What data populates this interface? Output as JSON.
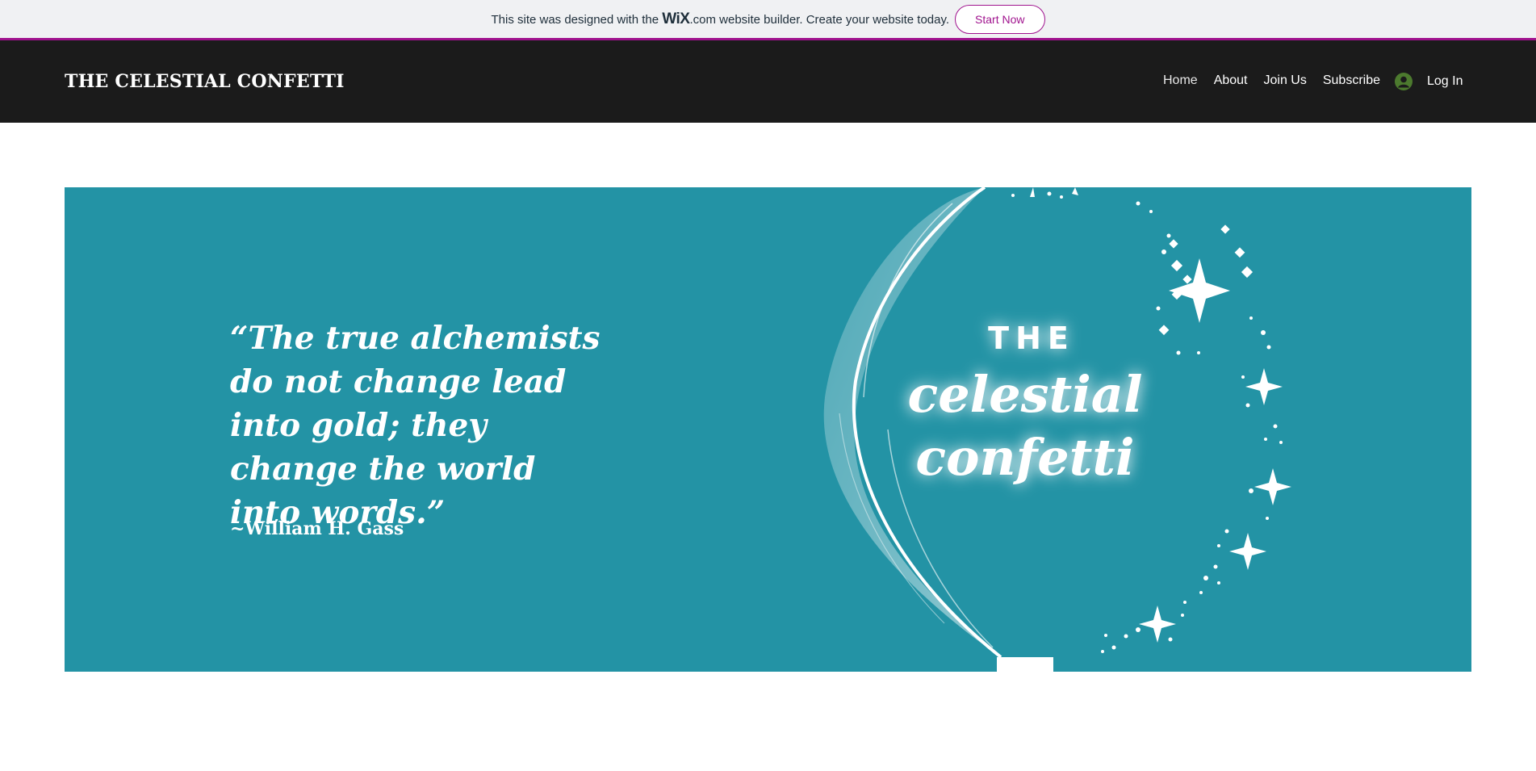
{
  "wix_banner": {
    "text_before": "This site was designed with the ",
    "logo_text": "WiX",
    "text_after": ".com website builder. Create your website today.",
    "button_label": "Start Now"
  },
  "header": {
    "site_title": "THE CELESTIAL CONFETTI",
    "nav": [
      "Home",
      "About",
      "Join Us",
      "Subscribe"
    ],
    "login_label": "Log In",
    "login_icon": "user-avatar-icon"
  },
  "hero": {
    "quote": "“The true alchemists do not change lead into gold; they change the world into words.”",
    "attribution": "~William H. Gass",
    "logo_line1": "THE",
    "logo_line2": "celestial",
    "logo_line3": "confetti",
    "background_color": "#2393a5"
  },
  "colors": {
    "accent": "#a0138e",
    "header_bg": "#1b1b1b",
    "login_icon": "#4c7a2e"
  }
}
